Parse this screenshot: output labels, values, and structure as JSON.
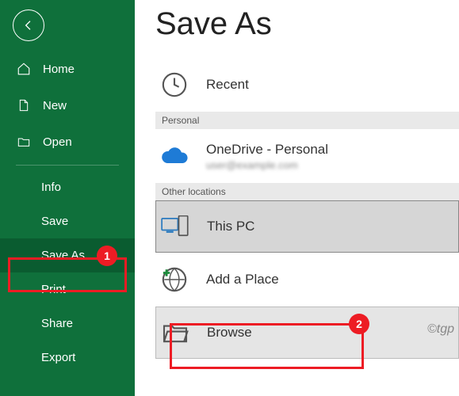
{
  "sidebar": {
    "home": "Home",
    "new": "New",
    "open": "Open",
    "info": "Info",
    "save": "Save",
    "save_as": "Save As",
    "print": "Print",
    "share": "Share",
    "export": "Export"
  },
  "main": {
    "title": "Save As",
    "recent": "Recent",
    "personal_header": "Personal",
    "onedrive": "OneDrive - Personal",
    "onedrive_sub": "user@example.com",
    "other_header": "Other locations",
    "this_pc": "This PC",
    "add_place": "Add a Place",
    "browse": "Browse"
  },
  "annotations": {
    "badge1": "1",
    "badge2": "2",
    "watermark": "©tgp"
  }
}
